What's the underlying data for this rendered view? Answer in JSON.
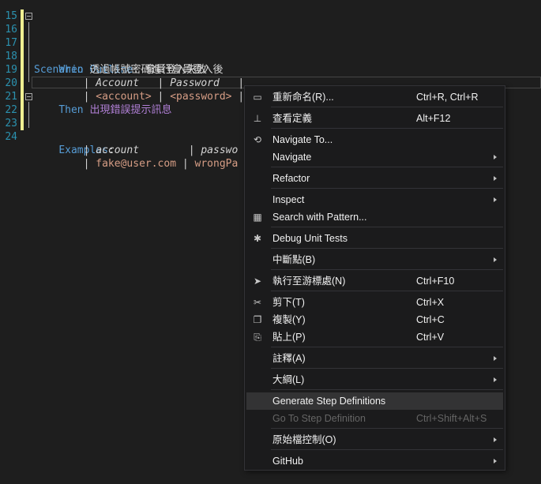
{
  "editor": {
    "lines": [
      {
        "num": "15"
      },
      {
        "num": "16",
        "kw": "Scenario Outline",
        "rest": ": 會員登入失敗"
      },
      {
        "num": "17",
        "kw": "When",
        "rest": " 透過帳號密碼進行會員登入後"
      },
      {
        "num": "18",
        "pipe1": "| ",
        "c1": "Account",
        "pipe2": "   | ",
        "c2": "Password",
        "pipe3": "   |"
      },
      {
        "num": "19",
        "pipe1": "| ",
        "c1": "<account>",
        "pipe2": " | ",
        "c2": "<password>",
        "pipe3": " |"
      },
      {
        "num": "20",
        "kw": "Then",
        "rest": " 出現錯誤提示訊息"
      },
      {
        "num": "21"
      },
      {
        "num": "22",
        "kw": "Examples",
        "rest": ":"
      },
      {
        "num": "23",
        "pipe1": "| ",
        "c1": "account",
        "pipe2": "        | ",
        "c2": "passwo"
      },
      {
        "num": "24",
        "pipe1": "| ",
        "c1": "fake@user.com",
        "pipe2": " | ",
        "c2": "wrongPa"
      }
    ]
  },
  "context_menu": {
    "items": [
      {
        "icon": "rename-icon",
        "glyph": "▭",
        "label": "重新命名(R)...",
        "shortcut": "Ctrl+R, Ctrl+R"
      },
      {
        "icon": "go-to-definition-icon",
        "glyph": "⊥",
        "label": "查看定義",
        "shortcut": "Alt+F12"
      },
      {
        "icon": "navigate-to-icon",
        "glyph": "⟲",
        "label": "Navigate To...",
        "shortcut": ""
      },
      {
        "icon": "",
        "glyph": "",
        "label": "Navigate",
        "shortcut": "",
        "submenu": true
      },
      {
        "icon": "",
        "glyph": "",
        "label": "Refactor",
        "shortcut": "",
        "submenu": true
      },
      {
        "icon": "",
        "glyph": "",
        "label": "Inspect",
        "shortcut": "",
        "submenu": true
      },
      {
        "icon": "search-pattern-icon",
        "glyph": "▦",
        "label": "Search with Pattern...",
        "shortcut": ""
      },
      {
        "icon": "debug-bug-icon",
        "glyph": "✱",
        "label": "Debug Unit Tests",
        "shortcut": ""
      },
      {
        "icon": "",
        "glyph": "",
        "label": "中斷點(B)",
        "shortcut": "",
        "submenu": true
      },
      {
        "icon": "pointer-icon",
        "glyph": "➤",
        "label": "執行至游標處(N)",
        "shortcut": "Ctrl+F10"
      },
      {
        "icon": "cut-icon",
        "glyph": "✂",
        "label": "剪下(T)",
        "shortcut": "Ctrl+X"
      },
      {
        "icon": "copy-icon",
        "glyph": "❐",
        "label": "複製(Y)",
        "shortcut": "Ctrl+C"
      },
      {
        "icon": "paste-icon",
        "glyph": "⎘",
        "label": "貼上(P)",
        "shortcut": "Ctrl+V"
      },
      {
        "icon": "",
        "glyph": "",
        "label": "註釋(A)",
        "shortcut": "",
        "submenu": true
      },
      {
        "icon": "",
        "glyph": "",
        "label": "大綱(L)",
        "shortcut": "",
        "submenu": true
      },
      {
        "icon": "",
        "glyph": "",
        "label": "Generate Step Definitions",
        "shortcut": "",
        "highlighted": true
      },
      {
        "icon": "",
        "glyph": "",
        "label": "Go To Step Definition",
        "shortcut": "Ctrl+Shift+Alt+S",
        "disabled": true
      },
      {
        "icon": "",
        "glyph": "",
        "label": "原始檔控制(O)",
        "shortcut": "",
        "submenu": true
      },
      {
        "icon": "",
        "glyph": "",
        "label": "GitHub",
        "shortcut": "",
        "submenu": true
      }
    ]
  }
}
